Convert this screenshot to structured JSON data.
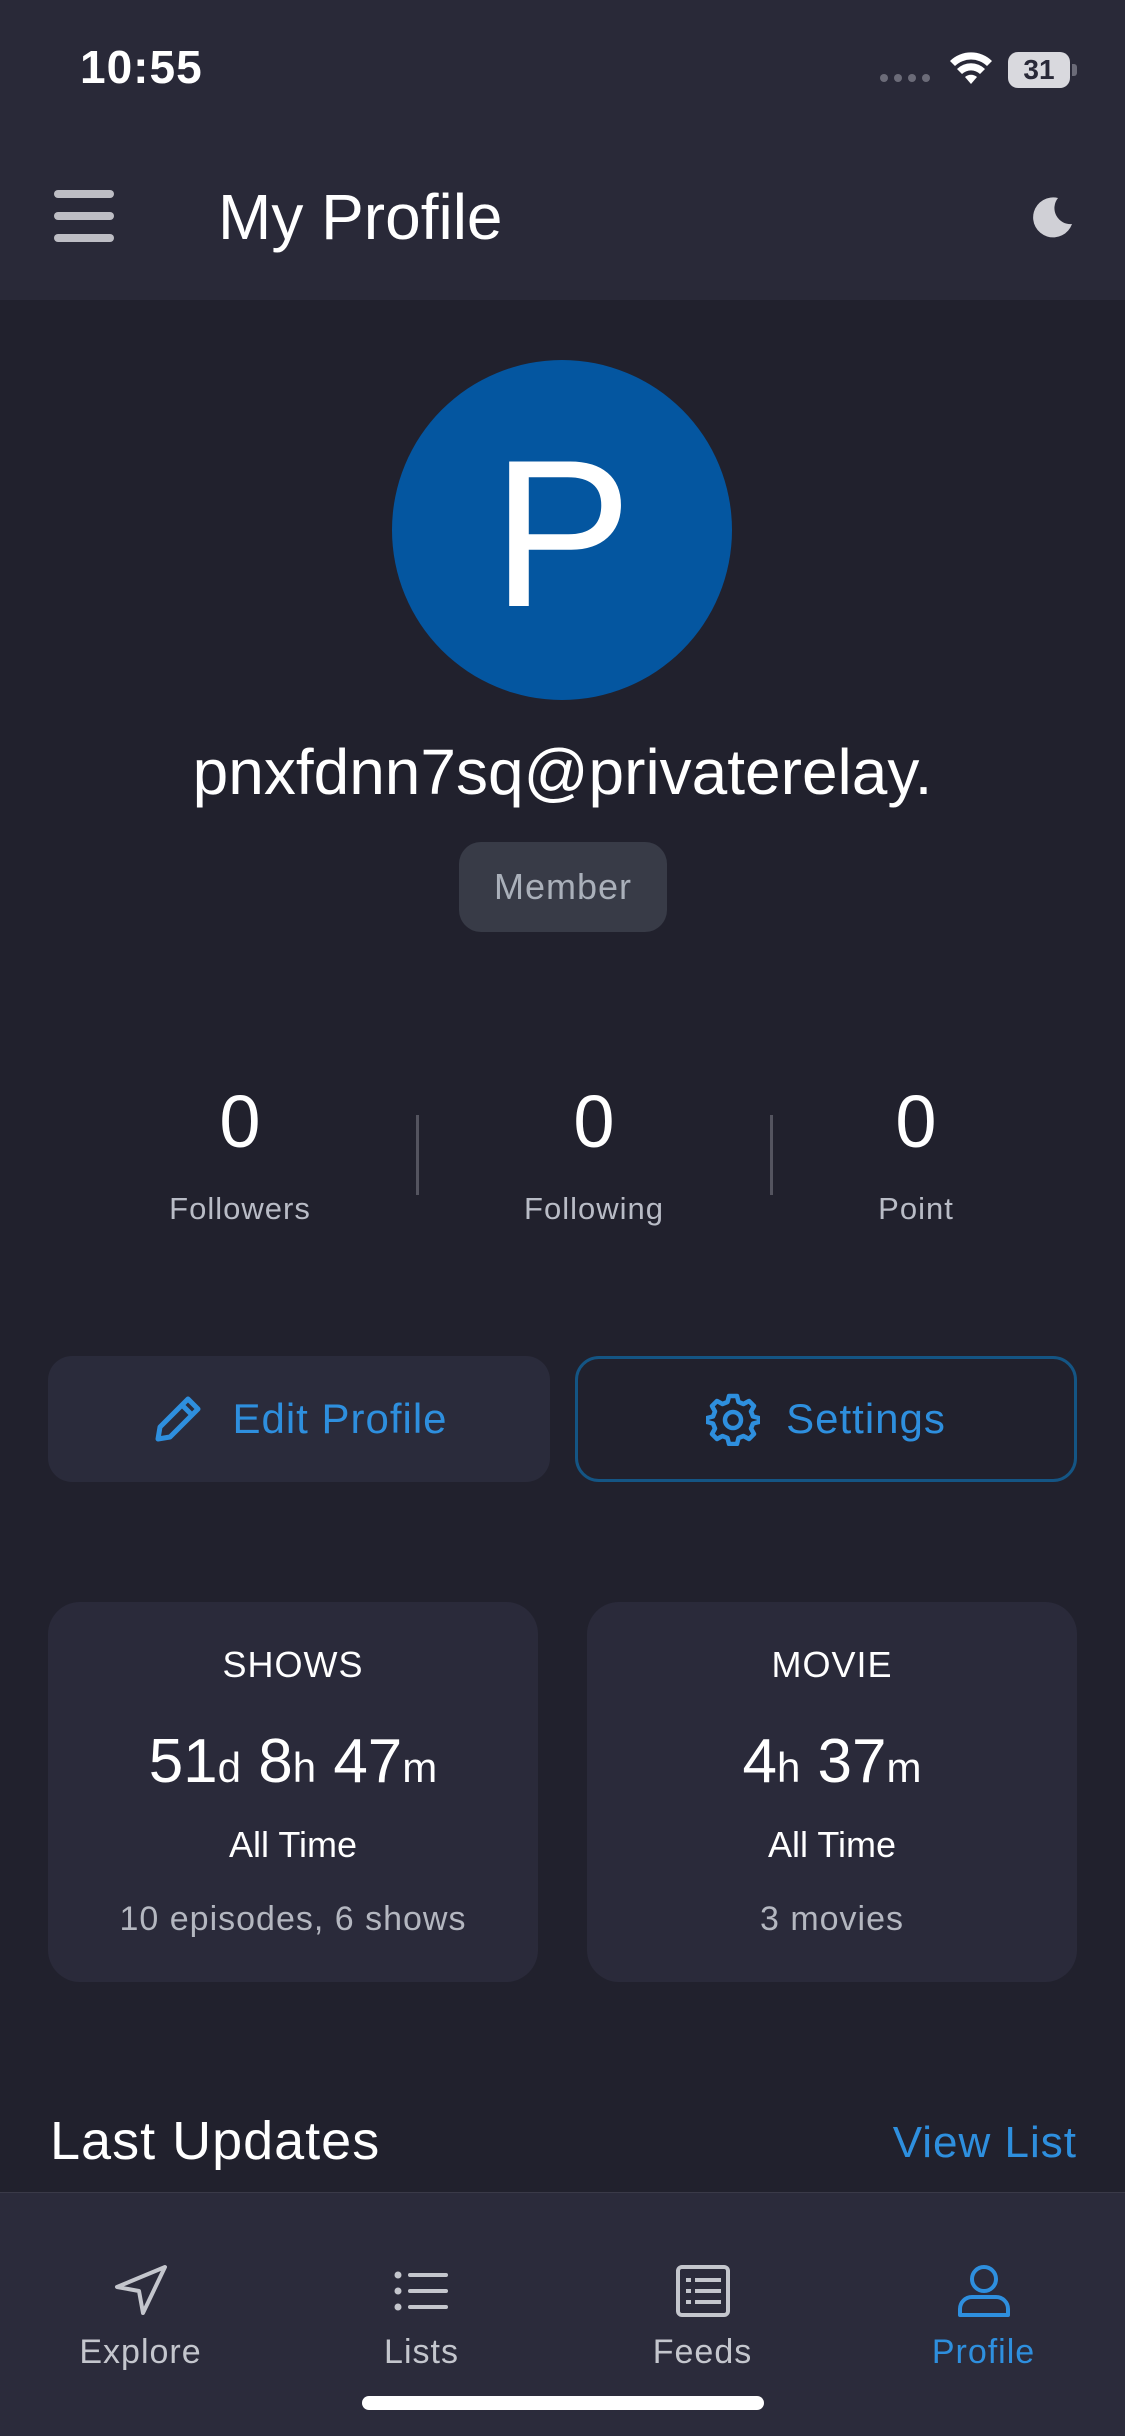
{
  "status_bar": {
    "time": "10:55",
    "battery": "31"
  },
  "header": {
    "title": "My Profile",
    "menu_icon": "hamburger-menu-icon",
    "theme_icon": "moon-icon"
  },
  "profile": {
    "avatar_letter": "P",
    "avatar_color": "#0456a0",
    "username": "pnxfdnn7sq@privaterelay.",
    "role": "Member"
  },
  "stats": [
    {
      "value": "0",
      "label": "Followers"
    },
    {
      "value": "0",
      "label": "Following"
    },
    {
      "value": "0",
      "label": "Point"
    }
  ],
  "actions": {
    "edit_profile": "Edit Profile",
    "settings": "Settings"
  },
  "time_cards": {
    "shows": {
      "title": "SHOWS",
      "days": "51",
      "days_unit": "d",
      "hours": "8",
      "hours_unit": "h",
      "minutes": "47",
      "minutes_unit": "m",
      "period": "All Time",
      "sub": "10 episodes, 6 shows"
    },
    "movie": {
      "title": "MOVIE",
      "hours": "4",
      "hours_unit": "h",
      "minutes": "37",
      "minutes_unit": "m",
      "period": "All Time",
      "sub": "3 movies"
    }
  },
  "last_updates": {
    "title": "Last Updates",
    "view_list": "View List"
  },
  "tabs": [
    {
      "label": "Explore",
      "icon": "navigation-arrow-icon",
      "active": false
    },
    {
      "label": "Lists",
      "icon": "list-icon",
      "active": false
    },
    {
      "label": "Feeds",
      "icon": "news-feed-icon",
      "active": false
    },
    {
      "label": "Profile",
      "icon": "user-icon",
      "active": true
    }
  ],
  "colors": {
    "accent": "#2e8fde",
    "background": "#21212d",
    "surface": "#2a2a3a"
  }
}
